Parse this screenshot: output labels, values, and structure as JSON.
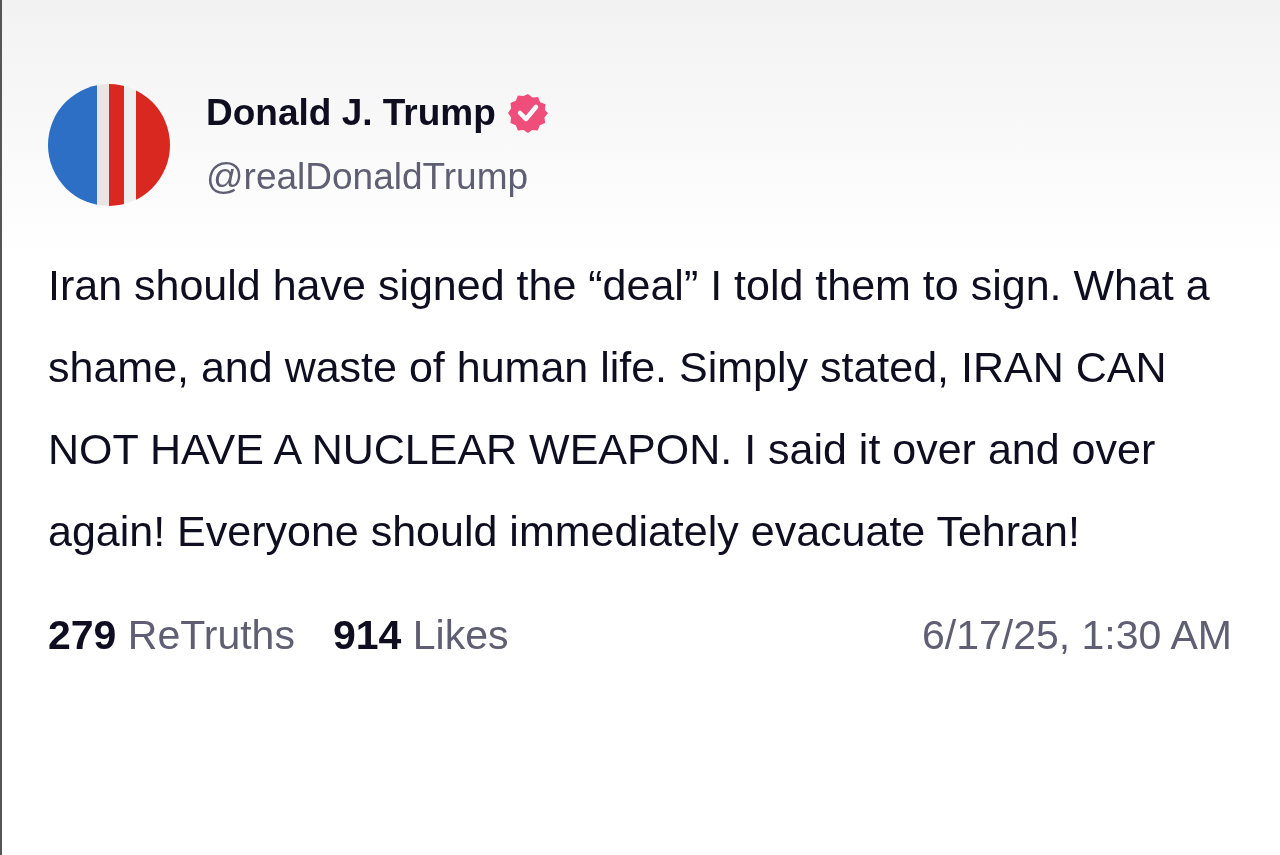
{
  "post": {
    "author": {
      "name": "Donald J. Trump",
      "verified": true,
      "handle": "@realDonaldTrump"
    },
    "text": "Iran should have signed the “deal” I told them to sign. What a shame, and waste of human life. Simply stated, IRAN CAN NOT HAVE A NUCLEAR WEAPON. I said it over and over again! Everyone should immediately evacuate Tehran!",
    "stats": [
      {
        "text": "**279** ReTruths"
      },
      {
        "text": "**914** Likes"
      }
    ],
    "timestamp": "6/17/25, 1:30 AM"
  }
}
